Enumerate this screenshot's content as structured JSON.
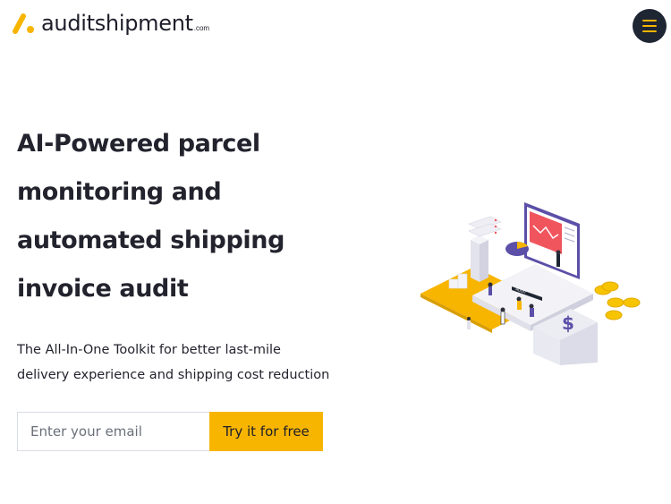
{
  "header": {
    "logo_name": "auditshipment",
    "logo_tld": ".com",
    "menu_icon": "hamburger-icon"
  },
  "hero": {
    "title_lines": [
      "AI-Powered parcel",
      "monitoring and",
      "automated shipping",
      "invoice audit"
    ],
    "subtitle_lines": [
      "The All-In-One Toolkit for better last-mile",
      "delivery experience and shipping cost reduction"
    ]
  },
  "signup": {
    "email_placeholder": "Enter your email",
    "cta_label": "Try it for free"
  },
  "illustration": {
    "icon": "dashboard-analytics-illustration",
    "screen_label": "AUDIT"
  },
  "colors": {
    "accent": "#f7b500",
    "dark": "#1e2533",
    "text": "#23232e",
    "illustration_purple": "#5b4fa8",
    "illustration_red": "#f0555e"
  }
}
